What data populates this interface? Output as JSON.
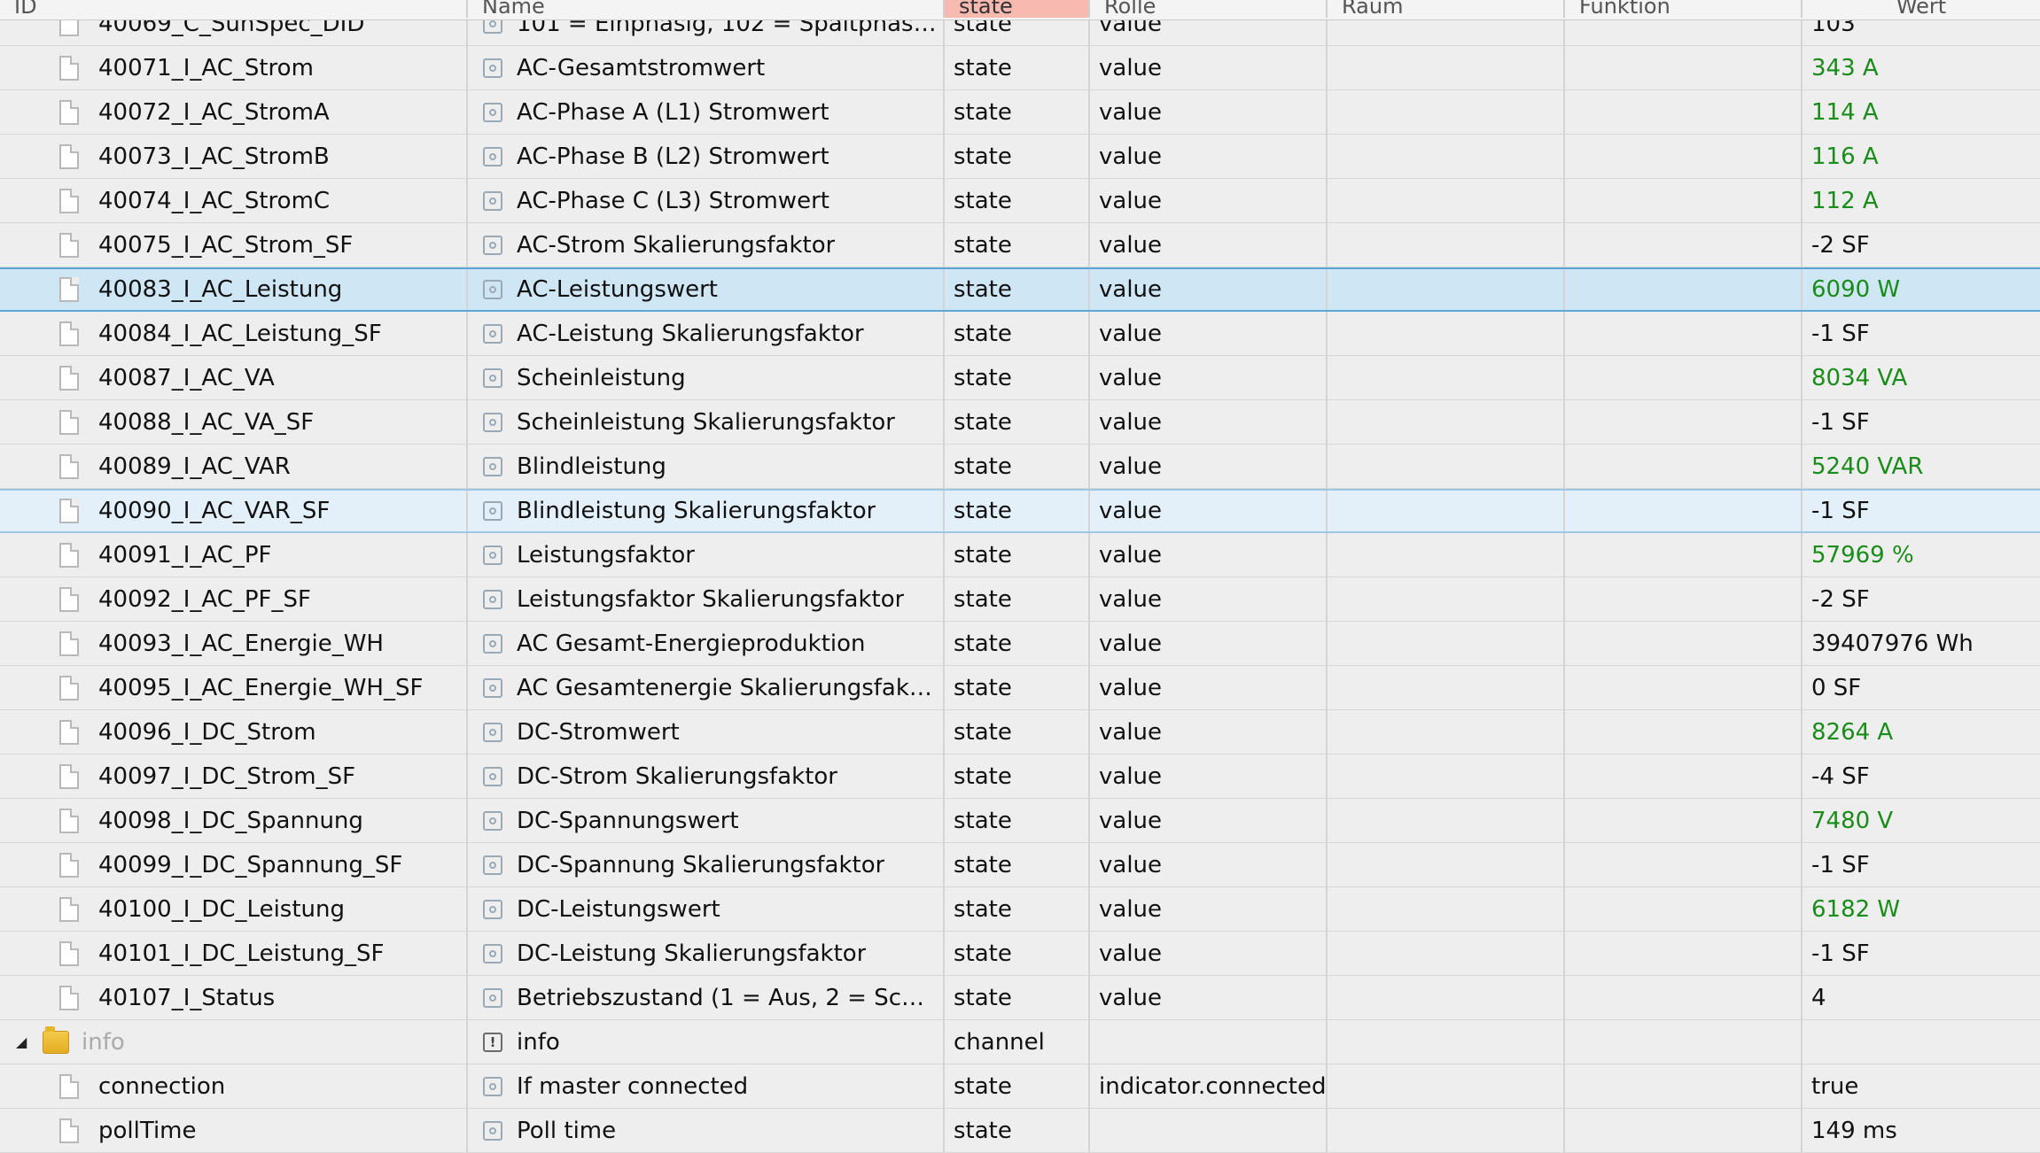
{
  "header": {
    "columns": {
      "id": "ID",
      "name": "Name",
      "type": "state",
      "role": "Rolle",
      "room": "Raum",
      "function": "Funktion",
      "value": "Wert"
    }
  },
  "colors": {
    "value_green": "#1a8c1a",
    "selected_row": "#cfe6f4",
    "sorted_header": "#f7b9b0"
  },
  "rows": [
    {
      "id": "40069_C_SunSpec_DID",
      "name": "101 = Einphasig, 102 = Spaltphase, 10...",
      "type": "state",
      "role": "value",
      "value": "103"
    },
    {
      "id": "40071_I_AC_Strom",
      "name": "AC-Gesamtstromwert",
      "type": "state",
      "role": "value",
      "value": "343 A"
    },
    {
      "id": "40072_I_AC_StromA",
      "name": "AC-Phase A (L1) Stromwert",
      "type": "state",
      "role": "value",
      "value": "114 A"
    },
    {
      "id": "40073_I_AC_StromB",
      "name": "AC-Phase B (L2) Stromwert",
      "type": "state",
      "role": "value",
      "value": "116 A"
    },
    {
      "id": "40074_I_AC_StromC",
      "name": "AC-Phase C (L3) Stromwert",
      "type": "state",
      "role": "value",
      "value": "112 A"
    },
    {
      "id": "40075_I_AC_Strom_SF",
      "name": "AC-Strom Skalierungsfaktor",
      "type": "state",
      "role": "value",
      "value": "-2 SF"
    },
    {
      "id": "40083_I_AC_Leistung",
      "name": "AC-Leistungswert",
      "type": "state",
      "role": "value",
      "value": "6090 W"
    },
    {
      "id": "40084_I_AC_Leistung_SF",
      "name": "AC-Leistung Skalierungsfaktor",
      "type": "state",
      "role": "value",
      "value": "-1 SF"
    },
    {
      "id": "40087_I_AC_VA",
      "name": "Scheinleistung",
      "type": "state",
      "role": "value",
      "value": "8034 VA"
    },
    {
      "id": "40088_I_AC_VA_SF",
      "name": "Scheinleistung Skalierungsfaktor",
      "type": "state",
      "role": "value",
      "value": "-1 SF"
    },
    {
      "id": "40089_I_AC_VAR",
      "name": "Blindleistung",
      "type": "state",
      "role": "value",
      "value": "5240 VAR"
    },
    {
      "id": "40090_I_AC_VAR_SF",
      "name": "Blindleistung Skalierungsfaktor",
      "type": "state",
      "role": "value",
      "value": "-1 SF"
    },
    {
      "id": "40091_I_AC_PF",
      "name": "Leistungsfaktor",
      "type": "state",
      "role": "value",
      "value": "57969 %"
    },
    {
      "id": "40092_I_AC_PF_SF",
      "name": "Leistungsfaktor Skalierungsfaktor",
      "type": "state",
      "role": "value",
      "value": "-2 SF"
    },
    {
      "id": "40093_I_AC_Energie_WH",
      "name": "AC Gesamt-Energieproduktion",
      "type": "state",
      "role": "value",
      "value": "39407976 Wh"
    },
    {
      "id": "40095_I_AC_Energie_WH_SF",
      "name": "AC Gesamtenergie Skalierungsfaktor",
      "type": "state",
      "role": "value",
      "value": "0 SF"
    },
    {
      "id": "40096_I_DC_Strom",
      "name": "DC-Stromwert",
      "type": "state",
      "role": "value",
      "value": "8264 A"
    },
    {
      "id": "40097_I_DC_Strom_SF",
      "name": "DC-Strom Skalierungsfaktor",
      "type": "state",
      "role": "value",
      "value": "-4 SF"
    },
    {
      "id": "40098_I_DC_Spannung",
      "name": "DC-Spannungswert",
      "type": "state",
      "role": "value",
      "value": "7480 V"
    },
    {
      "id": "40099_I_DC_Spannung_SF",
      "name": "DC-Spannung Skalierungsfaktor",
      "type": "state",
      "role": "value",
      "value": "-1 SF"
    },
    {
      "id": "40100_I_DC_Leistung",
      "name": "DC-Leistungswert",
      "type": "state",
      "role": "value",
      "value": "6182 W"
    },
    {
      "id": "40101_I_DC_Leistung_SF",
      "name": "DC-Leistung Skalierungsfaktor",
      "type": "state",
      "role": "value",
      "value": "-1 SF"
    },
    {
      "id": "40107_I_Status",
      "name": "Betriebszustand (1 = Aus, 2 = Schlafen...",
      "type": "state",
      "role": "value",
      "value": "4"
    },
    {
      "id": "info",
      "name": "info",
      "type": "channel",
      "role": "",
      "value": ""
    },
    {
      "id": "connection",
      "name": "If master connected",
      "type": "state",
      "role": "indicator.connected",
      "value": "true"
    },
    {
      "id": "pollTime",
      "name": "Poll time",
      "type": "state",
      "role": "",
      "value": "149 ms"
    }
  ]
}
